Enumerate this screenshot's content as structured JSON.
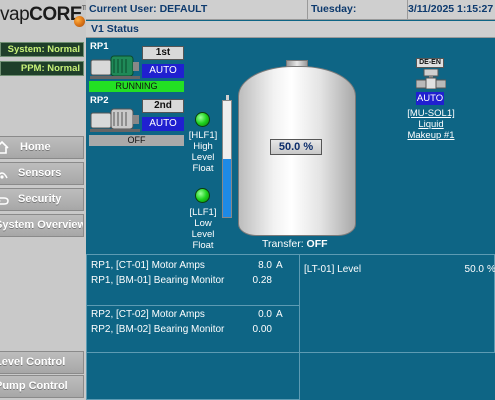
{
  "brand": {
    "prefix": "vap",
    "name": "CORE",
    "tm": "TM"
  },
  "sidebar": {
    "statuses": [
      "System: Normal",
      "PPM: Normal"
    ],
    "nav": [
      "Home",
      "Sensors",
      "Security",
      "System Overview"
    ],
    "bottom_nav": [
      "Level Control",
      "Pump Control"
    ]
  },
  "topbar": {
    "user": "Current User: DEFAULT",
    "weekday": "Tuesday:",
    "datetime": "3/11/2025 1:15:27 PM"
  },
  "page_title": "V1 Status",
  "pumps": [
    {
      "name": "RP1",
      "rank": "1st",
      "mode": "AUTO",
      "state": "RUNNING",
      "state_color": "#23e023"
    },
    {
      "name": "RP2",
      "rank": "2nd",
      "mode": "AUTO",
      "state": "OFF",
      "state_color": "#a9a9a9"
    }
  ],
  "floats": [
    {
      "tag": "[HLF1]",
      "desc": [
        "High",
        "Level",
        "Float"
      ]
    },
    {
      "tag": "[LLF1]",
      "desc": [
        "Low",
        "Level",
        "Float"
      ]
    }
  ],
  "tank": {
    "level_display": "50.0 %",
    "level_fraction": 0.5,
    "transfer_label": "Transfer:",
    "transfer_state": "OFF"
  },
  "valve": {
    "tag": "DE-EN",
    "mode": "AUTO",
    "lines": [
      "[MU-SOL1]",
      "Liquid",
      "Makeup #1"
    ]
  },
  "panels": {
    "rp1": [
      {
        "label": "RP1, [CT-01] Motor Amps",
        "value": "8.0",
        "unit": "A"
      },
      {
        "label": "RP1, [BM-01] Bearing Monitor",
        "value": "0.28",
        "unit": ""
      }
    ],
    "rp2": [
      {
        "label": "RP2, [CT-02] Motor Amps",
        "value": "0.0",
        "unit": "A"
      },
      {
        "label": "RP2, [BM-02] Bearing Monitor",
        "value": "0.00",
        "unit": ""
      }
    ],
    "level": {
      "label": "[LT-01] Level",
      "value": "50.0",
      "unit": "%"
    }
  },
  "colors": {
    "background": "#0e6585",
    "auto": "#2020d0",
    "float_on": "#1ed31e",
    "status_text": "#c9f27a"
  },
  "icons": {
    "home": "home-icon",
    "sensors": "sensor-icon",
    "security": "security-icon"
  }
}
